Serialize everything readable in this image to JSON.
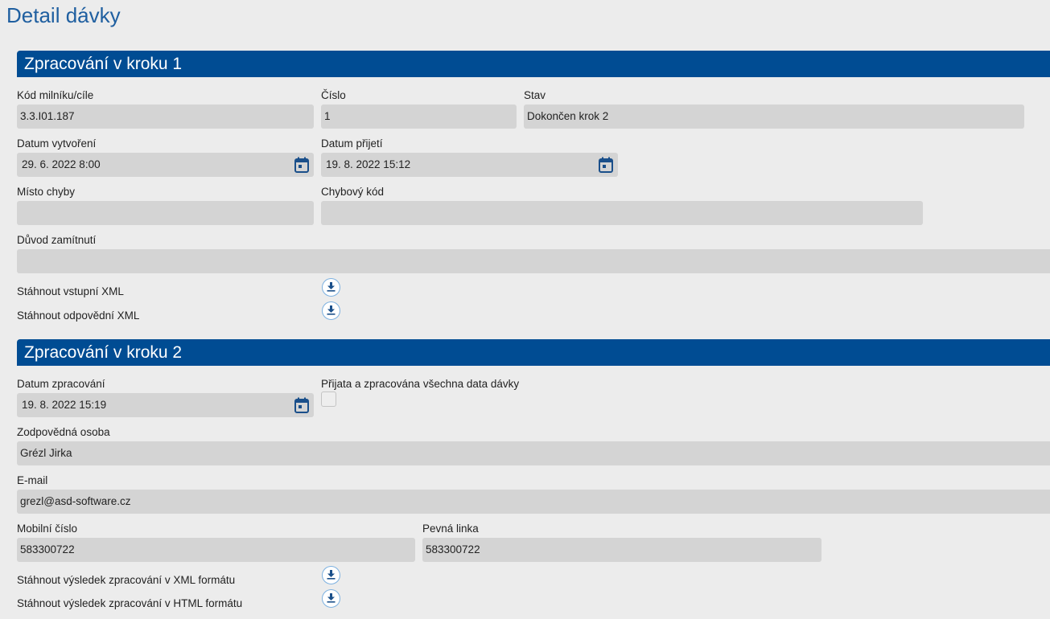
{
  "page": {
    "title": "Detail dávky"
  },
  "step1": {
    "header": "Zpracování v kroku 1",
    "milestone_code": {
      "label": "Kód milníku/cíle",
      "value": "3.3.I01.187"
    },
    "number": {
      "label": "Číslo",
      "value": "1"
    },
    "status": {
      "label": "Stav",
      "value": "Dokončen krok 2"
    },
    "created_date": {
      "label": "Datum vytvoření",
      "value": "29. 6. 2022 8:00"
    },
    "received_date": {
      "label": "Datum přijetí",
      "value": "19. 8. 2022 15:12"
    },
    "error_location": {
      "label": "Místo chyby",
      "value": ""
    },
    "error_code": {
      "label": "Chybový kód",
      "value": ""
    },
    "rejection_reason": {
      "label": "Důvod zamítnutí",
      "value": ""
    },
    "download_input_xml": {
      "label": "Stáhnout vstupní XML"
    },
    "download_response_xml": {
      "label": "Stáhnout odpovědní XML"
    }
  },
  "step2": {
    "header": "Zpracování v kroku 2",
    "processed_date": {
      "label": "Datum zpracování",
      "value": "19. 8. 2022 15:19"
    },
    "all_data_received": {
      "label": "Přijata a zpracována všechna data dávky",
      "checked": false
    },
    "responsible_person": {
      "label": "Zodpovědná osoba",
      "value": "Grézl Jirka"
    },
    "email": {
      "label": "E-mail",
      "value": "grezl@asd-software.cz"
    },
    "mobile": {
      "label": "Mobilní číslo",
      "value": "583300722"
    },
    "landline": {
      "label": "Pevná linka",
      "value": "583300722"
    },
    "download_result_xml": {
      "label": "Stáhnout výsledek zpracování v XML formátu"
    },
    "download_result_html": {
      "label": "Stáhnout výsledek zpracování v HTML formátu"
    }
  },
  "icons": {
    "calendar": "calendar-icon",
    "download": "download-icon"
  },
  "colors": {
    "header_bg": "#004c93",
    "title": "#1f5fa0",
    "field_bg": "#d4d4d4",
    "accent": "#1a4f8a"
  }
}
